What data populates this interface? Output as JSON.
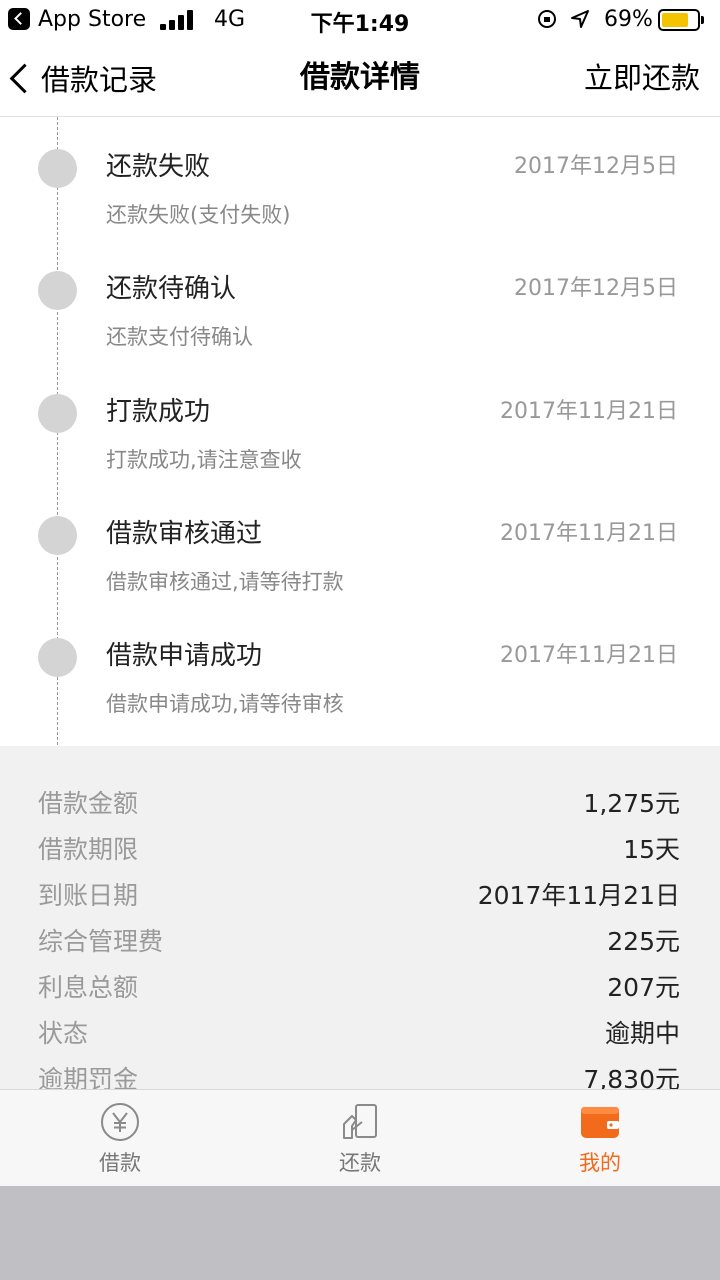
{
  "status_bar": {
    "app": "App Store",
    "network": "4G",
    "time": "下午1:49",
    "battery": "69%"
  },
  "nav": {
    "back_label": "借款记录",
    "title": "借款详情",
    "action": "立即还款"
  },
  "timeline": [
    {
      "title": "还款失败",
      "date": "2017年12月5日",
      "desc": "还款失败(支付失败)"
    },
    {
      "title": "还款待确认",
      "date": "2017年12月5日",
      "desc": "还款支付待确认"
    },
    {
      "title": "打款成功",
      "date": "2017年11月21日",
      "desc": "打款成功,请注意查收"
    },
    {
      "title": "借款审核通过",
      "date": "2017年11月21日",
      "desc": "借款审核通过,请等待打款"
    },
    {
      "title": "借款申请成功",
      "date": "2017年11月21日",
      "desc": "借款申请成功,请等待审核"
    }
  ],
  "details": [
    {
      "label": "借款金额",
      "value": "1,275元"
    },
    {
      "label": "借款期限",
      "value": "15天"
    },
    {
      "label": "到账日期",
      "value": "2017年11月21日"
    },
    {
      "label": "综合管理费",
      "value": "225元"
    },
    {
      "label": "利息总额",
      "value": "207元"
    },
    {
      "label": "状态",
      "value": "逾期中"
    },
    {
      "label": "逾期罚金",
      "value": "7,830元"
    }
  ],
  "tabs": [
    {
      "label": "借款",
      "icon": "yuan-coin-icon",
      "active": false
    },
    {
      "label": "还款",
      "icon": "repay-card-icon",
      "active": false
    },
    {
      "label": "我的",
      "icon": "wallet-icon",
      "active": true
    }
  ],
  "colors": {
    "accent": "#f26a1b",
    "battery": "#f5c400",
    "timeline_dot": "#d4d4d4",
    "details_bg": "#f1f1f1"
  }
}
